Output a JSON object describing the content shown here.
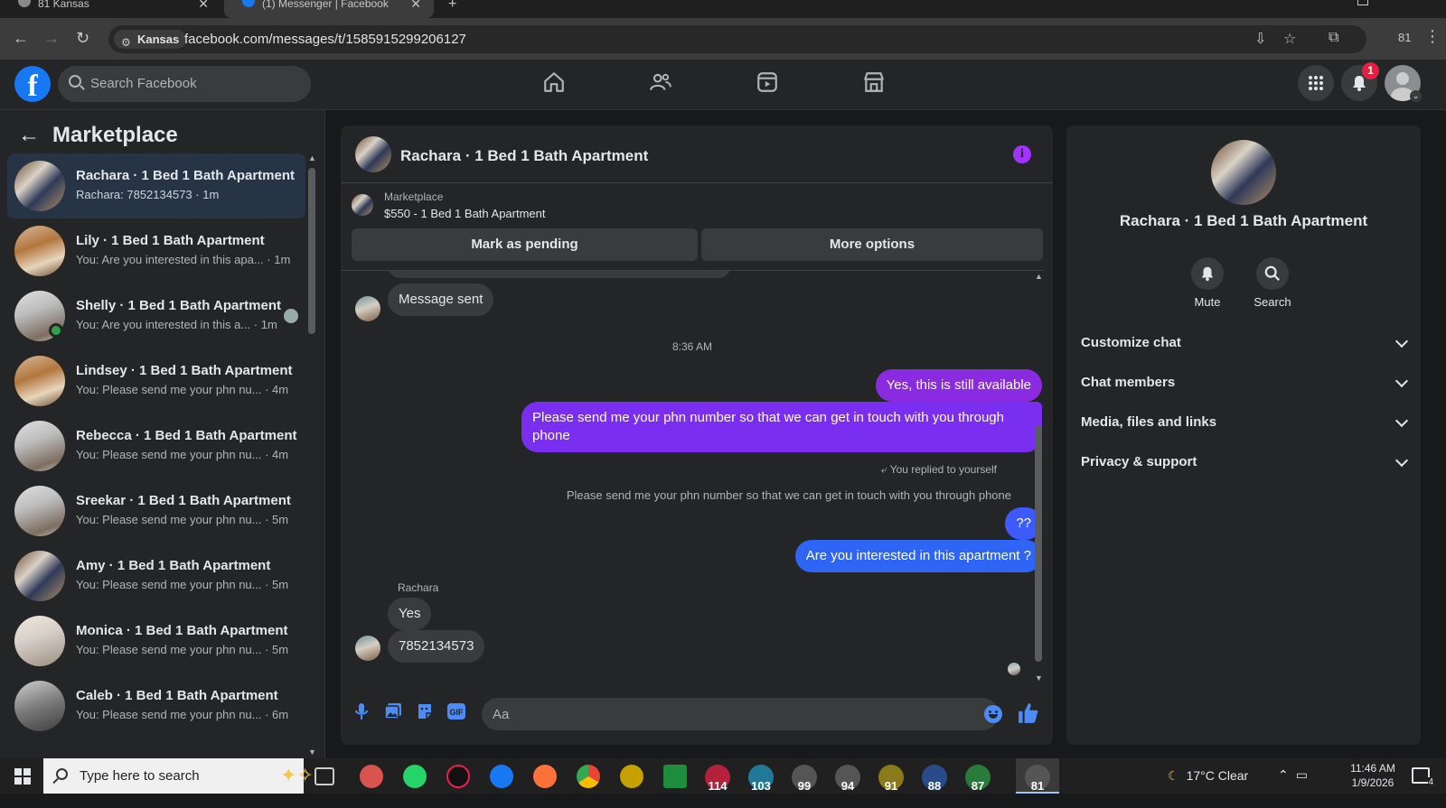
{
  "browser": {
    "tabs": [
      {
        "label": "81 Kansas",
        "active": false
      },
      {
        "label": "(1) Messenger | Facebook",
        "active": true
      }
    ],
    "new_tab": "+",
    "site_chip": "Kansas",
    "url": "facebook.com/messages/t/1585915299206127",
    "profile_count": "81"
  },
  "facebook": {
    "logo": "f",
    "search_placeholder": "Search Facebook",
    "notification_count": "1",
    "nav_icons": [
      "home-icon",
      "friends-icon",
      "video-icon",
      "marketplace-icon"
    ],
    "colors": {
      "brand": "#1877f2",
      "badge": "#e41e3f",
      "active_item": "#263445"
    }
  },
  "sidebar": {
    "title": "Marketplace",
    "conversations": [
      {
        "name": "Rachara · 1 Bed 1 Bath Apartment",
        "preview": "Rachara: 7852134573 · 1m",
        "active": true
      },
      {
        "name": "Lily · 1 Bed 1 Bath Apartment",
        "preview": "You: Are you interested in this apa... · 1m"
      },
      {
        "name": "Shelly · 1 Bed 1 Bath Apartment",
        "preview": "You: Are you interested in this a... · 1m",
        "online": true
      },
      {
        "name": "Lindsey · 1 Bed 1 Bath Apartment",
        "preview": "You: Please send me your phn nu... · 4m"
      },
      {
        "name": "Rebecca · 1 Bed 1 Bath Apartment",
        "preview": "You: Please send me your phn nu... · 4m"
      },
      {
        "name": "Sreekar · 1 Bed 1 Bath Apartment",
        "preview": "You: Please send me your phn nu... · 5m"
      },
      {
        "name": "Amy · 1 Bed 1 Bath Apartment",
        "preview": "You: Please send me your phn nu... · 5m"
      },
      {
        "name": "Monica · 1 Bed 1 Bath Apartment",
        "preview": "You: Please send me your phn nu... · 5m"
      },
      {
        "name": "Caleb · 1 Bed 1 Bath Apartment",
        "preview": "You: Please send me your phn nu... · 6m"
      }
    ]
  },
  "chat": {
    "title": "Rachara · 1 Bed 1 Bath Apartment",
    "marketplace_label": "Marketplace",
    "listing": "$550 - 1 Bed 1 Bath Apartment",
    "buttons": {
      "mark_pending": "Mark as pending",
      "more_options": "More options"
    },
    "messages": {
      "message_sent": "Message sent",
      "timestamp": "8:36 AM",
      "out1": "Yes, this is still available",
      "out2": "Please send me your phn number so that we can get in touch with you through phone",
      "reply_note": "You replied to yourself",
      "reply_quote": "Please send me your phn number so that we can get in touch with you through phone",
      "out3": "??",
      "out4": "Are you interested in this apartment ?",
      "sender": "Rachara",
      "in1": "Yes",
      "in2": "7852134573"
    },
    "composer_placeholder": "Aa"
  },
  "details": {
    "name": "Rachara · 1 Bed 1 Bath Apartment",
    "actions": {
      "mute": "Mute",
      "search": "Search"
    },
    "sections": [
      "Customize chat",
      "Chat members",
      "Media, files and links",
      "Privacy & support"
    ]
  },
  "taskbar": {
    "search_placeholder": "Type here to search",
    "badges": [
      "114",
      "103",
      "99",
      "94",
      "91",
      "88",
      "87",
      "81"
    ],
    "weather": "17°C  Clear",
    "time": "11:46 AM",
    "date": "1/9/2026",
    "notifications": "4"
  }
}
